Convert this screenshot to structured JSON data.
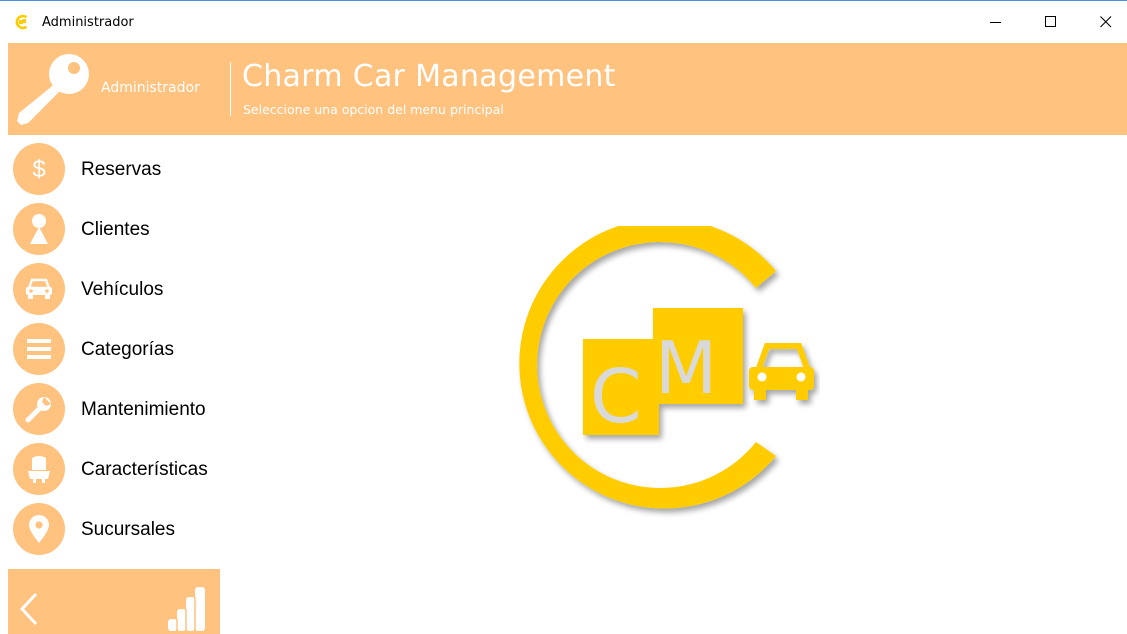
{
  "window": {
    "title": "Administrador",
    "icon": "charm-app-icon",
    "controls": [
      "minimize-icon",
      "maximize-icon",
      "close-icon"
    ]
  },
  "header": {
    "user_icon": "key-icon",
    "user_label": "Administrador",
    "app_title": "Charm Car Management",
    "subtitle": "Seleccione una opcion del menu principal"
  },
  "menu": {
    "items": [
      {
        "label": "Reservas",
        "icon": "dollar-icon"
      },
      {
        "label": "Clientes",
        "icon": "person-icon"
      },
      {
        "label": "Vehículos",
        "icon": "car-icon"
      },
      {
        "label": "Categorías",
        "icon": "list-icon"
      },
      {
        "label": "Mantenimiento",
        "icon": "wrench-icon"
      },
      {
        "label": "Características",
        "icon": "car-seat-icon"
      },
      {
        "label": "Sucursales",
        "icon": "location-pin-icon"
      }
    ]
  },
  "bottom_bar": {
    "back_icon": "back-arrow-icon",
    "stats_icon": "bar-chart-icon"
  },
  "logo": {
    "letters": [
      "C",
      "M"
    ],
    "icon": "car-icon"
  },
  "colors": {
    "accent": "#ffc27f",
    "logo_yellow": "#ffcc00",
    "logo_letter": "#d9d9d9",
    "window_border": "#4a90d9"
  }
}
